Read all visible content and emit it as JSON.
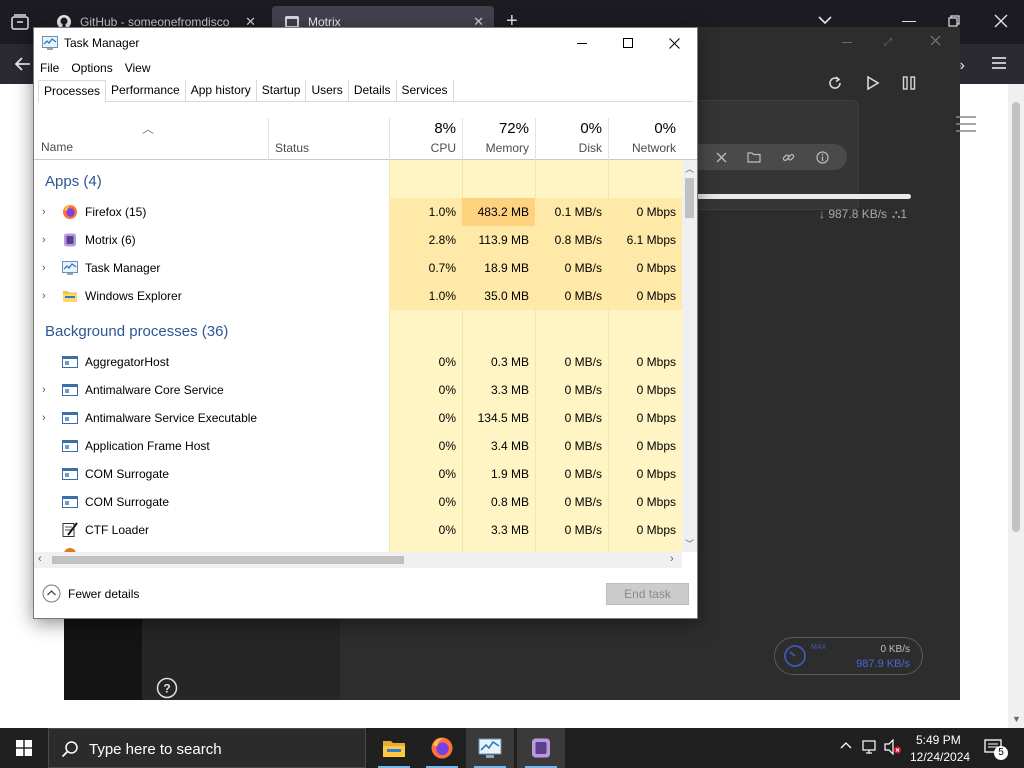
{
  "browser": {
    "tabs": [
      {
        "title": "GitHub - someonefromdiscord",
        "close": "✕"
      },
      {
        "title": "Motrix",
        "close": "✕"
      }
    ],
    "new_tab": "+"
  },
  "motrix": {
    "task_speed": "↓ 987.8 KB/s",
    "task_connections": "1",
    "task_progress": 1.0,
    "speed_mode": "MAX",
    "upload_speed": "0 KB/s",
    "download_speed": "987.9 KB/s"
  },
  "taskmgr": {
    "title": "Task Manager",
    "menu": [
      "File",
      "Options",
      "View"
    ],
    "tabs": [
      "Processes",
      "Performance",
      "App history",
      "Startup",
      "Users",
      "Details",
      "Services"
    ],
    "active_tab": "Processes",
    "columns": {
      "name": "Name",
      "status": "Status",
      "cpu": {
        "pct": "8%",
        "label": "CPU"
      },
      "memory": {
        "pct": "72%",
        "label": "Memory"
      },
      "disk": {
        "pct": "0%",
        "label": "Disk"
      },
      "network": {
        "pct": "0%",
        "label": "Network"
      }
    },
    "groups": {
      "apps": "Apps (4)",
      "background": "Background processes (36)"
    },
    "apps": [
      {
        "name": "Firefox (15)",
        "cpu": "1.0%",
        "memory": "483.2 MB",
        "disk": "0.1 MB/s",
        "network": "0 Mbps",
        "icon": "firefox-icon"
      },
      {
        "name": "Motrix (6)",
        "cpu": "2.8%",
        "memory": "113.9 MB",
        "disk": "0.8 MB/s",
        "network": "6.1 Mbps",
        "icon": "motrix-icon"
      },
      {
        "name": "Task Manager",
        "cpu": "0.7%",
        "memory": "18.9 MB",
        "disk": "0 MB/s",
        "network": "0 Mbps",
        "icon": "task-manager-icon"
      },
      {
        "name": "Windows Explorer",
        "cpu": "1.0%",
        "memory": "35.0 MB",
        "disk": "0 MB/s",
        "network": "0 Mbps",
        "icon": "explorer-icon"
      }
    ],
    "background": [
      {
        "name": "AggregatorHost",
        "cpu": "0%",
        "memory": "0.3 MB",
        "disk": "0 MB/s",
        "network": "0 Mbps",
        "icon": "service-icon"
      },
      {
        "name": "Antimalware Core Service",
        "cpu": "0%",
        "memory": "3.3 MB",
        "disk": "0 MB/s",
        "network": "0 Mbps",
        "icon": "service-icon"
      },
      {
        "name": "Antimalware Service Executable",
        "cpu": "0%",
        "memory": "134.5 MB",
        "disk": "0 MB/s",
        "network": "0 Mbps",
        "icon": "service-icon"
      },
      {
        "name": "Application Frame Host",
        "cpu": "0%",
        "memory": "3.4 MB",
        "disk": "0 MB/s",
        "network": "0 Mbps",
        "icon": "service-icon"
      },
      {
        "name": "COM Surrogate",
        "cpu": "0%",
        "memory": "1.9 MB",
        "disk": "0 MB/s",
        "network": "0 Mbps",
        "icon": "service-icon"
      },
      {
        "name": "COM Surrogate",
        "cpu": "0%",
        "memory": "0.8 MB",
        "disk": "0 MB/s",
        "network": "0 Mbps",
        "icon": "service-icon"
      },
      {
        "name": "CTF Loader",
        "cpu": "0%",
        "memory": "3.3 MB",
        "disk": "0 MB/s",
        "network": "0 Mbps",
        "icon": "ctf-loader-icon"
      }
    ],
    "fewer_details": "Fewer details",
    "end_task": "End task"
  },
  "taskbar": {
    "search_placeholder": "Type here to search",
    "time": "5:49 PM",
    "date": "12/24/2024",
    "notification_count": "5"
  }
}
